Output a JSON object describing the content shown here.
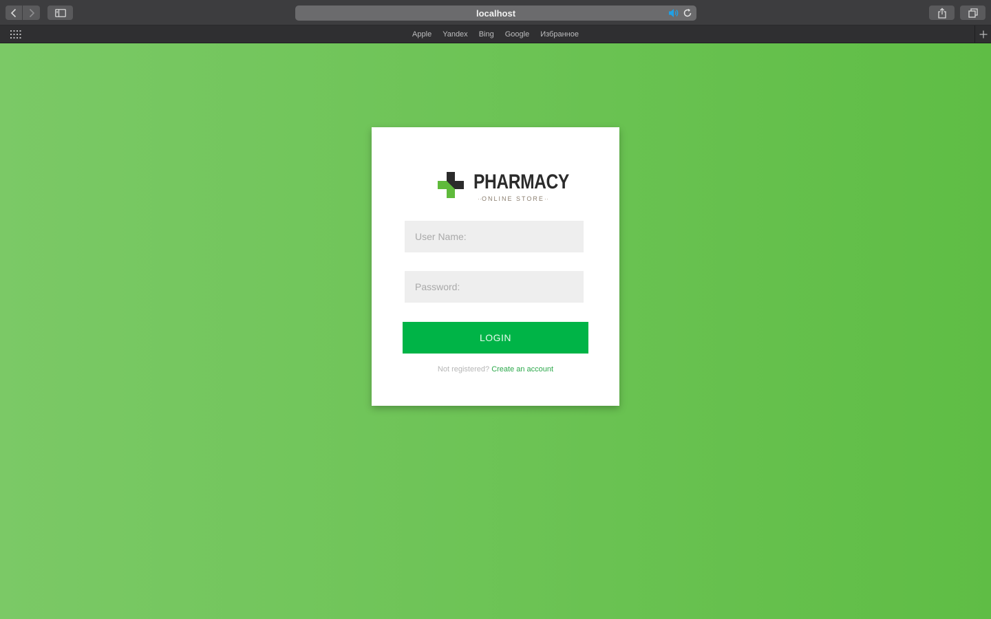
{
  "browser": {
    "address": "localhost",
    "favorites": [
      "Apple",
      "Yandex",
      "Bing",
      "Google",
      "Избранное"
    ],
    "accent_color": "#1fa0e6"
  },
  "login": {
    "brand_name": "PHARMACY",
    "brand_subtitle": "ONLINE STORE",
    "username_placeholder": "User Name:",
    "password_placeholder": "Password:",
    "login_label": "LOGIN",
    "not_registered": "Not registered?",
    "create_account": "Create an account",
    "button_color": "#00b447",
    "background_color": "#6ec457"
  }
}
